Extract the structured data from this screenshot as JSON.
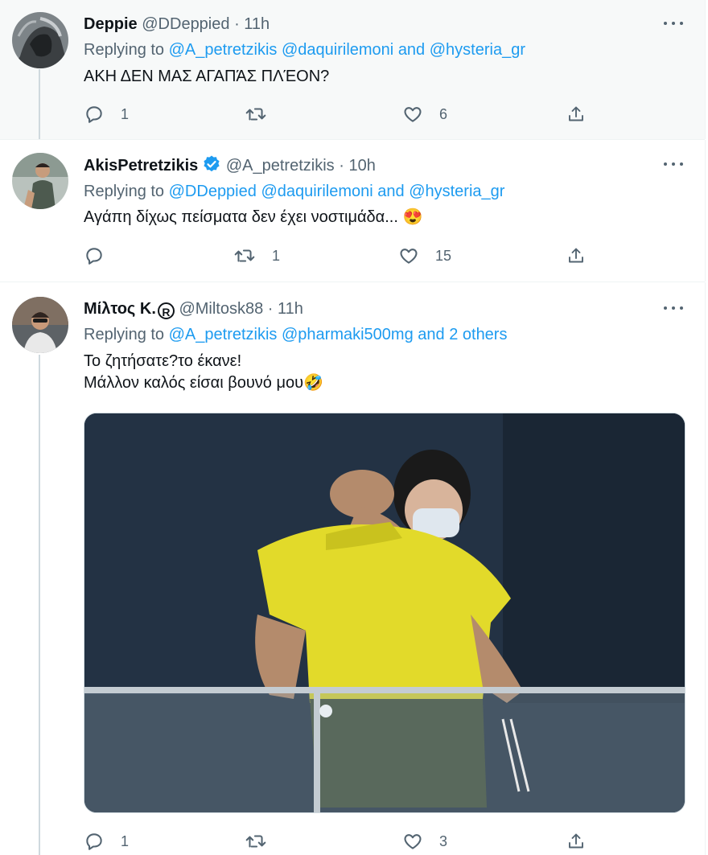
{
  "tweets": [
    {
      "name": "Deppie",
      "handle": "@DDeppied",
      "dot": "·",
      "time": "11h",
      "replying_prefix": "Replying to",
      "replying_mentions": [
        "@A_petretzikis",
        "@daquirilemoni"
      ],
      "replying_and": "and",
      "replying_last": "@hysteria_gr",
      "text_lines": [
        "ΑΚΗ ΔΕΝ ΜΑΣ ΑΓΑΠΆΣ ΠΛΈΟΝ?"
      ],
      "counts": {
        "replies": "1",
        "retweets": "",
        "likes": "6"
      }
    },
    {
      "name": "AkisPetretzikis",
      "verified": true,
      "handle": "@A_petretzikis",
      "dot": "·",
      "time": "10h",
      "replying_prefix": "Replying to",
      "replying_mentions": [
        "@DDeppied",
        "@daquirilemoni"
      ],
      "replying_and": "and",
      "replying_last": "@hysteria_gr",
      "text_lines": [
        "Αγάπη δίχως πείσματα δεν έχει νοστιμάδα... 😍"
      ],
      "counts": {
        "replies": "",
        "retweets": "1",
        "likes": "15"
      }
    },
    {
      "name": "Μίλτος Κ.",
      "name_badge": "R",
      "handle": "@Miltosk88",
      "dot": "·",
      "time": "11h",
      "replying_prefix": "Replying to",
      "replying_mentions": [
        "@A_petretzikis",
        "@pharmaki500mg"
      ],
      "replying_and": "and",
      "replying_last": "2 others",
      "text_lines": [
        "Το ζητήσατε?το έκανε!",
        "Μάλλον καλός είσαι βουνό μου🤣"
      ],
      "counts": {
        "replies": "1",
        "retweets": "",
        "likes": "3"
      }
    }
  ],
  "icons": [
    "reply-icon",
    "retweet-icon",
    "like-icon",
    "share-icon",
    "more-icon",
    "verified-badge-icon"
  ],
  "colors": {
    "link": "#1d9bf0",
    "secondary": "#536471",
    "verified": "#1d9bf0",
    "highlight_bg": "#f7f9f9"
  }
}
